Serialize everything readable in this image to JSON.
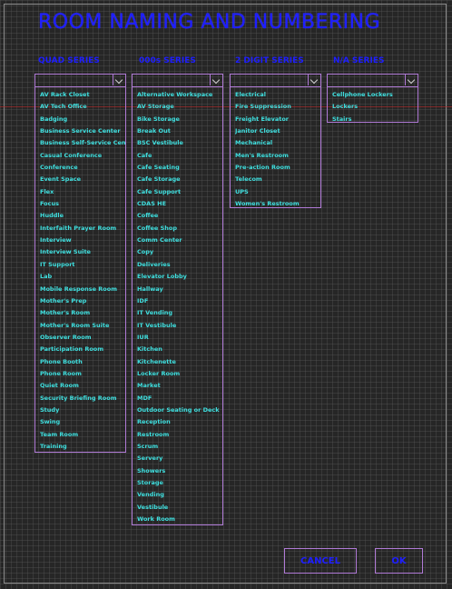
{
  "dialog": {
    "title": "ROOM NAMING AND NUMBERING"
  },
  "columns": [
    {
      "header": "QUAD SERIES",
      "items": [
        {
          "label": "AV Rack Closet",
          "color": "green"
        },
        {
          "label": "AV Tech Office",
          "color": "cyan"
        },
        {
          "label": "Badging",
          "color": "cyan"
        },
        {
          "label": "Business Service Center",
          "color": "cyan"
        },
        {
          "label": "Business Self-Service Center",
          "color": "cyan"
        },
        {
          "label": "Casual Conference",
          "color": "cyan"
        },
        {
          "label": "Conference",
          "color": "cyan"
        },
        {
          "label": "Event Space",
          "color": "cyan"
        },
        {
          "label": "Flex",
          "color": "magenta"
        },
        {
          "label": "Focus",
          "color": "cyan"
        },
        {
          "label": "Huddle",
          "color": "cyan"
        },
        {
          "label": "Interfaith Prayer Room",
          "color": "cyan"
        },
        {
          "label": "Interview",
          "color": "cyan"
        },
        {
          "label": "Interview Suite",
          "color": "cyan"
        },
        {
          "label": "IT Support",
          "color": "cyan"
        },
        {
          "label": "Lab",
          "color": "magenta"
        },
        {
          "label": "Mobile Response Room",
          "color": "cyan"
        },
        {
          "label": "Mother's Prep",
          "color": "cyan"
        },
        {
          "label": "Mother's Room",
          "color": "cyan"
        },
        {
          "label": "Mother's Room Suite",
          "color": "cyan"
        },
        {
          "label": "Observer Room",
          "color": "cyan"
        },
        {
          "label": "Participation Room",
          "color": "cyan"
        },
        {
          "label": "Phone Booth",
          "color": "cyan"
        },
        {
          "label": "Phone Room",
          "color": "cyan"
        },
        {
          "label": "Quiet Room",
          "color": "cyan"
        },
        {
          "label": "Security Briefing Room",
          "color": "cyan"
        },
        {
          "label": "Study",
          "color": "cyan"
        },
        {
          "label": "Swing",
          "color": "cyan"
        },
        {
          "label": "Team Room",
          "color": "cyan"
        },
        {
          "label": "Training",
          "color": "cyan"
        }
      ]
    },
    {
      "header": "000s SERIES",
      "items": [
        {
          "label": "Alternative Workspace",
          "color": "green"
        },
        {
          "label": "AV Storage",
          "color": "cyan"
        },
        {
          "label": "Bike Storage",
          "color": "cyan"
        },
        {
          "label": "Break Out",
          "color": "green"
        },
        {
          "label": "BSC Vestibule",
          "color": "green"
        },
        {
          "label": "Cafe",
          "color": "cyan"
        },
        {
          "label": "Cafe Seating",
          "color": "green"
        },
        {
          "label": "Cafe Storage",
          "color": "cyan"
        },
        {
          "label": "Cafe Support",
          "color": "cyan"
        },
        {
          "label": "CDAS HE",
          "color": "green"
        },
        {
          "label": "Coffee",
          "color": "cyan"
        },
        {
          "label": "Coffee Shop",
          "color": "cyan"
        },
        {
          "label": "Comm Center",
          "color": "cyan"
        },
        {
          "label": "Copy",
          "color": "cyan"
        },
        {
          "label": "Deliveries",
          "color": "green"
        },
        {
          "label": "Elevator Lobby",
          "color": "cyan"
        },
        {
          "label": "Hallway",
          "color": "magenta"
        },
        {
          "label": "IDF",
          "color": "green"
        },
        {
          "label": "IT Vending",
          "color": "green"
        },
        {
          "label": "IT Vestibule",
          "color": "green"
        },
        {
          "label": "IUR",
          "color": "green"
        },
        {
          "label": "Kitchen",
          "color": "magenta"
        },
        {
          "label": "Kitchenette",
          "color": "cyan"
        },
        {
          "label": "Locker Room",
          "color": "cyan"
        },
        {
          "label": "Market",
          "color": "cyan"
        },
        {
          "label": "MDF",
          "color": "green"
        },
        {
          "label": "Outdoor Seating or Deck",
          "color": "cyan"
        },
        {
          "label": "Reception",
          "color": "cyan"
        },
        {
          "label": "Restroom",
          "color": "cyan"
        },
        {
          "label": "Scrum",
          "color": "cyan"
        },
        {
          "label": "Servery",
          "color": "green"
        },
        {
          "label": "Showers",
          "color": "cyan"
        },
        {
          "label": "Storage",
          "color": "cyan"
        },
        {
          "label": "Vending",
          "color": "cyan"
        },
        {
          "label": "Vestibule",
          "color": "green"
        },
        {
          "label": "Work Room",
          "color": "cyan"
        }
      ]
    },
    {
      "header": "2 DIGIT SERIES",
      "items": [
        {
          "label": "Electrical",
          "color": "green"
        },
        {
          "label": "Fire Suppression",
          "color": "green"
        },
        {
          "label": "Freight Elevator",
          "color": "cyan"
        },
        {
          "label": "Janitor Closet",
          "color": "green"
        },
        {
          "label": "Mechanical",
          "color": "green"
        },
        {
          "label": "Men's Restroom",
          "color": "cyan"
        },
        {
          "label": "Pre-action Room",
          "color": "green"
        },
        {
          "label": "Telecom",
          "color": "green"
        },
        {
          "label": "UPS",
          "color": "green"
        },
        {
          "label": "Women's Restroom",
          "color": "cyan"
        }
      ]
    },
    {
      "header": "N/A SERIES",
      "items": [
        {
          "label": "Cellphone Lockers",
          "color": "cyan"
        },
        {
          "label": "Lockers",
          "color": "cyan"
        },
        {
          "label": "Stairs",
          "color": "cyan"
        }
      ]
    }
  ],
  "buttons": {
    "cancel": "CANCEL",
    "ok": "OK"
  },
  "colors": {
    "title": "#1e1eff",
    "cyan": "#3fe0e0",
    "green": "#39ff39",
    "magenta": "#e06cf0",
    "border": "#b07ad6"
  }
}
